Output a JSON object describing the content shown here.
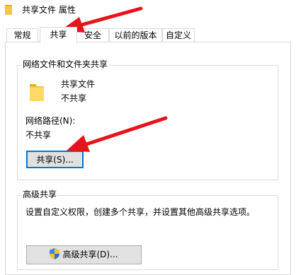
{
  "window": {
    "title": "共享文件 属性"
  },
  "tabs": [
    {
      "label": "常规"
    },
    {
      "label": "共享"
    },
    {
      "label": "安全"
    },
    {
      "label": "以前的版本"
    },
    {
      "label": "自定义"
    }
  ],
  "network_share": {
    "group_title": "网络文件和文件夹共享",
    "folder_name": "共享文件",
    "folder_status": "不共享",
    "path_label": "网络路径(N):",
    "path_value": "不共享",
    "share_button": "共享(S)..."
  },
  "advanced_share": {
    "group_title": "高级共享",
    "description": "设置自定义权限，创建多个共享，并设置其他高级共享选项。",
    "button": "高级共享(D)..."
  },
  "colors": {
    "arrow": "#e8141b",
    "folder": "#f5c842",
    "focus": "#0078d7"
  },
  "icons": [
    "folder-icon",
    "shield-icon",
    "red-arrow"
  ]
}
